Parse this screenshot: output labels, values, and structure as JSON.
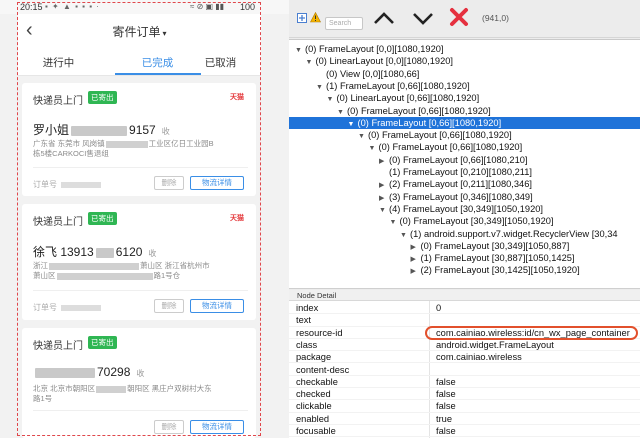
{
  "status_bar": {
    "time": "20:15",
    "left_icons": "▪ ✦ ▲ ▪ ▪ ▪ ·",
    "right_status": "≈ ⊘ ▣ ▮▮",
    "battery": "100"
  },
  "nav": {
    "back_icon": "chevron-left-icon",
    "title": "寄件订单"
  },
  "tabs": [
    "进行中",
    "已完成",
    "已取消"
  ],
  "orders": [
    {
      "title": "快递员上门",
      "badge": "已寄出",
      "tmall": "天猫",
      "name_prefix": "罗小姐",
      "phone_tail": "9157",
      "shou": "收",
      "address_a": "广东省 东莞市 风岗镇",
      "address_b": "工业区亿日工业园B",
      "address_c": "栋5楼CARKOCI售退组",
      "order_no_label": "订单号",
      "delete_label": "删除",
      "detail_label": "物流详情"
    },
    {
      "title": "快递员上门",
      "badge": "已寄出",
      "tmall": "天猫",
      "name_prefix": "徐飞 13913",
      "phone_tail": "6120",
      "shou": "收",
      "address_a": "浙江",
      "address_b": "萧山区 浙江省杭州市",
      "address_c": "萧山区",
      "address_d": "路1号仓",
      "order_no_label": "订单号",
      "delete_label": "删除",
      "detail_label": "物流详情"
    },
    {
      "title": "快递员上门",
      "badge": "已寄出",
      "tmall": "",
      "name_prefix": "",
      "phone_tail": "70298",
      "shou": "收",
      "address_a": "北京 北京市朝阳区",
      "address_b": "朝阳区 黑庄户双树村大东",
      "address_c": "路1号",
      "order_no_label": "订单号",
      "delete_label": "删除",
      "detail_label": "物流详情"
    }
  ],
  "inspector": {
    "toolbar": {
      "search_placeholder": "Search",
      "coord": "(941,0)",
      "icons": [
        "expand-icon",
        "warning-icon",
        "chevron-up-icon",
        "chevron-down-icon",
        "close-icon"
      ]
    },
    "tree": [
      {
        "depth": 0,
        "arrow": "▼",
        "text": "(0) FrameLayout [0,0][1080,1920]"
      },
      {
        "depth": 1,
        "arrow": "▼",
        "text": "(0) LinearLayout [0,0][1080,1920]"
      },
      {
        "depth": 2,
        "arrow": "",
        "text": "(0) View [0,0][1080,66]"
      },
      {
        "depth": 2,
        "arrow": "▼",
        "text": "(1) FrameLayout [0,66][1080,1920]"
      },
      {
        "depth": 3,
        "arrow": "▼",
        "text": "(0) LinearLayout [0,66][1080,1920]"
      },
      {
        "depth": 4,
        "arrow": "▼",
        "text": "(0) FrameLayout [0,66][1080,1920]"
      },
      {
        "depth": 5,
        "arrow": "▼",
        "text": "(0) FrameLayout [0,66][1080,1920]",
        "selected": true
      },
      {
        "depth": 6,
        "arrow": "▼",
        "text": "(0) FrameLayout [0,66][1080,1920]"
      },
      {
        "depth": 7,
        "arrow": "▼",
        "text": "(0) FrameLayout [0,66][1080,1920]"
      },
      {
        "depth": 8,
        "arrow": "▶",
        "text": "(0) FrameLayout [0,66][1080,210]"
      },
      {
        "depth": 8,
        "arrow": "",
        "text": "(1) FrameLayout [0,210][1080,211]"
      },
      {
        "depth": 8,
        "arrow": "▶",
        "text": "(2) FrameLayout [0,211][1080,346]"
      },
      {
        "depth": 8,
        "arrow": "▶",
        "text": "(3) FrameLayout [0,346][1080,349]"
      },
      {
        "depth": 8,
        "arrow": "▼",
        "text": "(4) FrameLayout [30,349][1050,1920]"
      },
      {
        "depth": 9,
        "arrow": "▼",
        "text": "(0) FrameLayout [30,349][1050,1920]"
      },
      {
        "depth": 10,
        "arrow": "▼",
        "text": "(1) android.support.v7.widget.RecyclerView [30,34"
      },
      {
        "depth": 11,
        "arrow": "▶",
        "text": "(0) FrameLayout [30,349][1050,887]"
      },
      {
        "depth": 11,
        "arrow": "▶",
        "text": "(1) FrameLayout [30,887][1050,1425]"
      },
      {
        "depth": 11,
        "arrow": "▶",
        "text": "(2) FrameLayout [30,1425][1050,1920]"
      }
    ],
    "detail_header": "Node Detail",
    "details": [
      {
        "k": "index",
        "v": "0"
      },
      {
        "k": "text",
        "v": ""
      },
      {
        "k": "resource-id",
        "v": "com.cainiao.wireless:id/cn_wx_page_container"
      },
      {
        "k": "class",
        "v": "android.widget.FrameLayout"
      },
      {
        "k": "package",
        "v": "com.cainiao.wireless"
      },
      {
        "k": "content-desc",
        "v": ""
      },
      {
        "k": "checkable",
        "v": "false"
      },
      {
        "k": "checked",
        "v": "false"
      },
      {
        "k": "clickable",
        "v": "false"
      },
      {
        "k": "enabled",
        "v": "true"
      },
      {
        "k": "focusable",
        "v": "false"
      }
    ]
  },
  "colors": {
    "accent": "#3a8ee6",
    "selection": "#1f73d9",
    "badge": "#2fb653",
    "tmall": "#e4393c",
    "highlight": "#e2502c"
  }
}
